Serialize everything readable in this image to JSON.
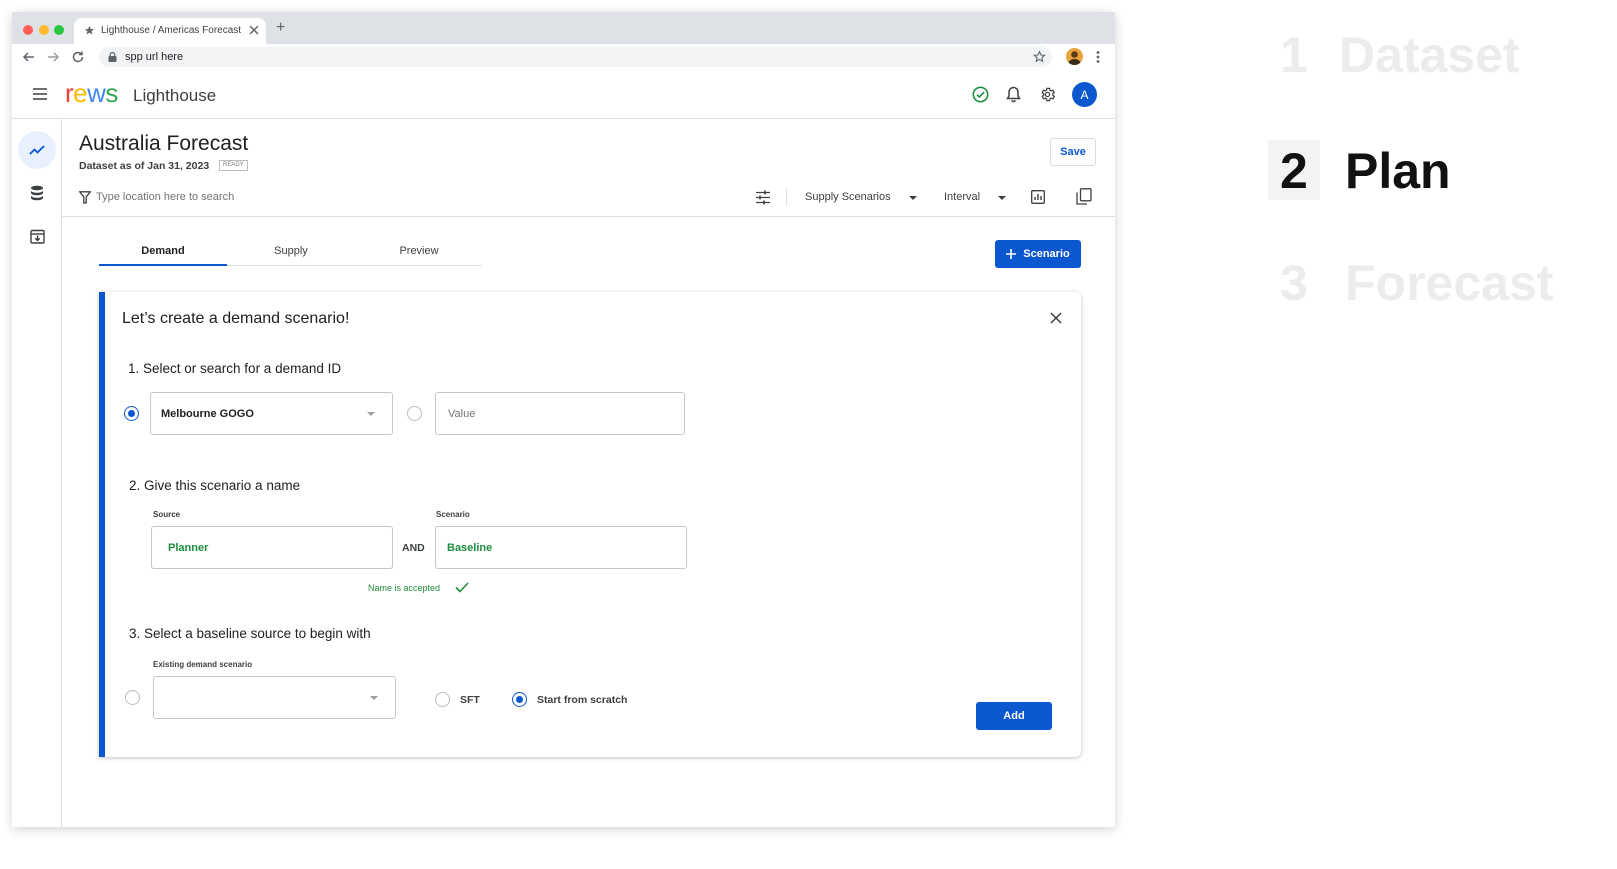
{
  "browser": {
    "tab_title": "Lighthouse / Americas Forecast",
    "new_tab_label": "+",
    "url": "spp url here"
  },
  "app": {
    "logo_text": "rews",
    "logo_letters": [
      "r",
      "e",
      "w",
      "s"
    ],
    "app_name": "Lighthouse",
    "avatar_initial": "A",
    "brand_colors": {
      "r": "#ea4335",
      "e": "#fbbc04",
      "w": "#4285f4",
      "s": "#34a853"
    }
  },
  "page": {
    "title": "Australia Forecast",
    "dataset_text": "Dataset as of Jan 31, 2023",
    "status_badge": "READY",
    "save_label": "Save"
  },
  "filter": {
    "search_placeholder": "Type location here to search",
    "supply_scenarios_label": "Supply Scenarios",
    "interval_label": "Interval"
  },
  "tabs": [
    {
      "label": "Demand",
      "active": true
    },
    {
      "label": "Supply",
      "active": false
    },
    {
      "label": "Preview",
      "active": false
    }
  ],
  "add_scenario_label": "Scenario",
  "card": {
    "title": "Let’s create a demand scenario!",
    "step1": {
      "heading": "1.  Select or search for a demand ID",
      "dropdown_value": "Melbourne GOGO",
      "value_placeholder": "Value"
    },
    "step2": {
      "heading": "2.  Give this scenario a name",
      "source_label": "Source",
      "source_value": "Planner",
      "and_label": "AND",
      "scenario_label": "Scenario",
      "scenario_value": "Baseline",
      "validation_message": "Name is accepted"
    },
    "step3": {
      "heading": "3.  Select a baseline source to begin with",
      "existing_label": "Existing demand scenario",
      "option_sft": "SFT",
      "option_scratch": "Start from scratch"
    },
    "add_label": "Add"
  },
  "steps": [
    {
      "number": "1",
      "label": "Dataset",
      "active": false
    },
    {
      "number": "2",
      "label": "Plan",
      "active": true
    },
    {
      "number": "3",
      "label": "Forecast",
      "active": false
    }
  ],
  "colors": {
    "primary": "#0b57d0",
    "success": "#1e8e3e",
    "inactive_step": "#ececec"
  }
}
